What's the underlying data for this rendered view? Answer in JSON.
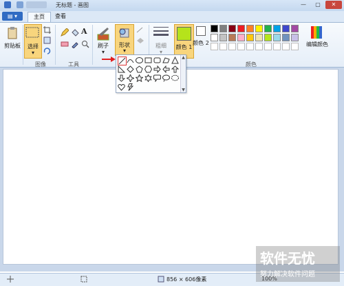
{
  "title_bar": {
    "title": "无标题 - 画图"
  },
  "tabs": [
    {
      "label": "主页",
      "active": true
    },
    {
      "label": "查看",
      "active": false
    }
  ],
  "ribbon": {
    "clipboard": {
      "paste_label": "剪贴板"
    },
    "image": {
      "select_label": "选择",
      "group_label": "图像"
    },
    "tools": {
      "group_label": "工具",
      "text_tool_glyph": "A"
    },
    "brush": {
      "label": "刷子"
    },
    "shapes": {
      "label": "形状"
    },
    "size": {
      "label": "粗细"
    },
    "color1": {
      "label": "颜色 1",
      "value": "#b5e31b"
    },
    "color2": {
      "label": "颜色 2",
      "value": "#ffffff"
    },
    "colors": {
      "group_label": "颜色",
      "edit_label": "编辑颜色",
      "palette_row1": [
        "#000000",
        "#7f7f7f",
        "#880015",
        "#ed1c24",
        "#ff7f27",
        "#fff200",
        "#22b14c",
        "#00a2e8",
        "#3f48cc",
        "#a349a4"
      ],
      "palette_row2": [
        "#ffffff",
        "#c3c3c3",
        "#b97a57",
        "#ffaec9",
        "#ffc90e",
        "#efe4b0",
        "#b5e61d",
        "#99d9ea",
        "#7092be",
        "#c8bfe7"
      ]
    }
  },
  "status_bar": {
    "dimensions": "856 × 606像素",
    "zoom": "100%"
  },
  "watermark": {
    "line1": "软件无忧",
    "line2": "努力解决软件问题"
  }
}
